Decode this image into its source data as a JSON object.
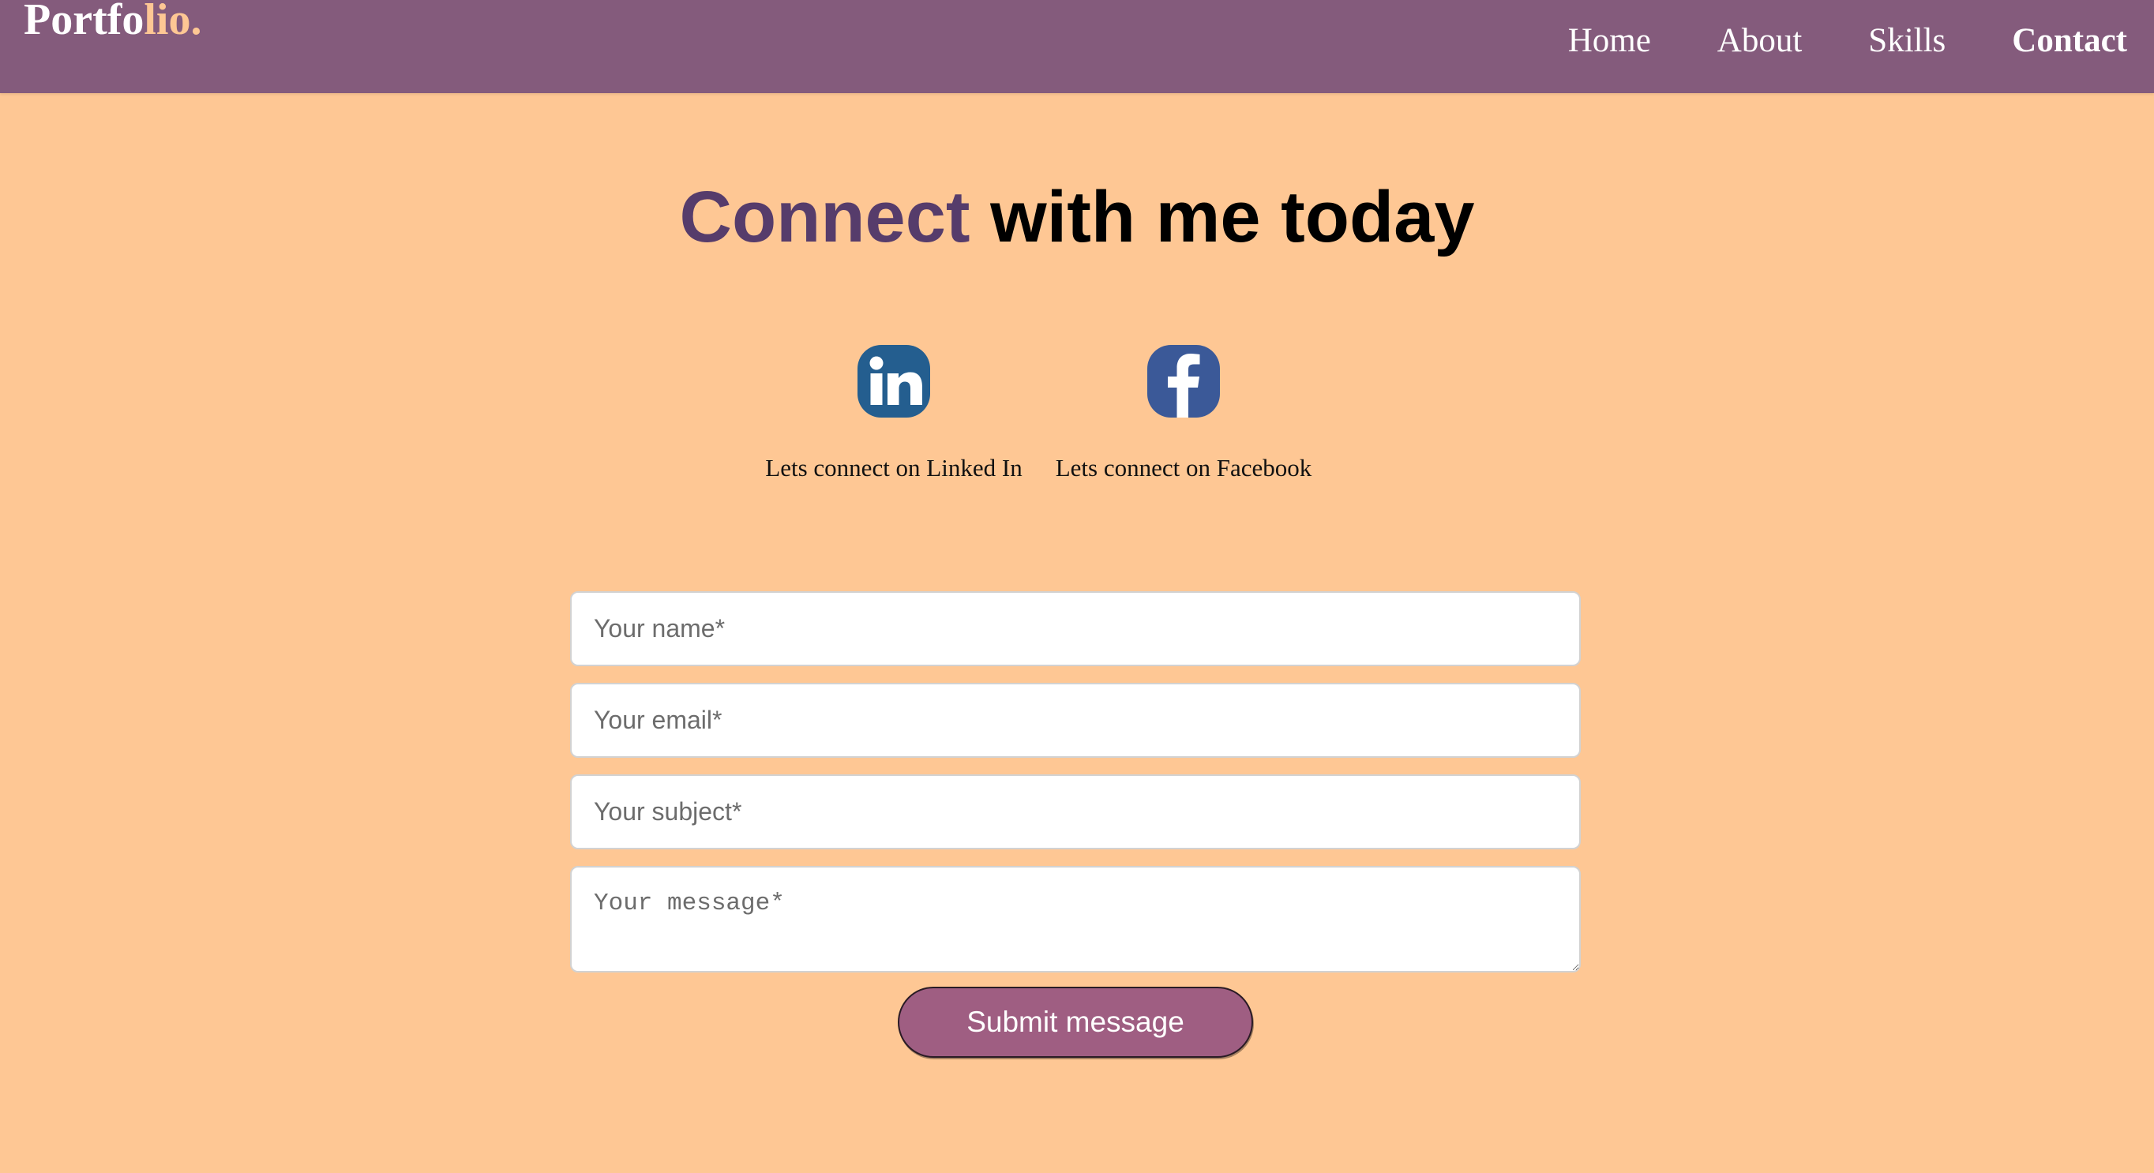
{
  "brand": {
    "part1": "Portfo",
    "part2": "lio."
  },
  "nav": {
    "home": "Home",
    "about": "About",
    "skills": "Skills",
    "contact": "Contact"
  },
  "heading": {
    "highlight": "Connect",
    "rest": " with me today"
  },
  "social": {
    "linkedin": {
      "icon": "linkedin-icon",
      "label": "Lets connect on Linked In"
    },
    "facebook": {
      "icon": "facebook-icon",
      "label": "Lets connect on Facebook"
    }
  },
  "form": {
    "name_placeholder": "Your name*",
    "email_placeholder": "Your email*",
    "subject_placeholder": "Your subject*",
    "message_placeholder": "Your message*",
    "submit_label": "Submit message"
  },
  "colors": {
    "header_bg": "#845b7c",
    "page_bg": "#fec794",
    "brand_accent": "#fec794",
    "heading_accent": "#563c6b",
    "button_bg": "#9f5e82",
    "linkedin_blue": "#245e8f",
    "facebook_blue": "#3b5998"
  }
}
